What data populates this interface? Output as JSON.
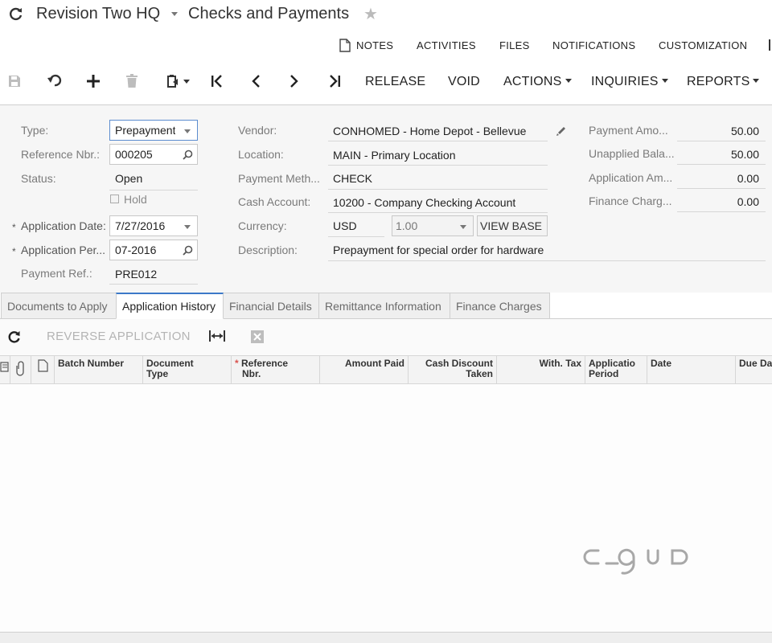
{
  "header": {
    "company": "Revision Two HQ",
    "title": "Checks and Payments"
  },
  "aux_links": [
    "NOTES",
    "ACTIVITIES",
    "FILES",
    "NOTIFICATIONS",
    "CUSTOMIZATION"
  ],
  "toolbar": {
    "release": "RELEASE",
    "void": "VOID",
    "actions": "ACTIONS",
    "inquiries": "INQUIRIES",
    "reports": "REPORTS"
  },
  "form": {
    "type_label": "Type:",
    "type_value": "Prepayment",
    "ref_label": "Reference Nbr.:",
    "ref_value": "000205",
    "status_label": "Status:",
    "status_value": "Open",
    "hold_label": "Hold",
    "app_date_label": "Application Date:",
    "app_date_value": "7/27/2016",
    "app_period_label": "Application Per...",
    "app_period_value": "07-2016",
    "payment_ref_label": "Payment Ref.:",
    "payment_ref_value": "PRE012",
    "vendor_label": "Vendor:",
    "vendor_value": "CONHOMED - Home Depot - Bellevue",
    "location_label": "Location:",
    "location_value": "MAIN - Primary Location",
    "payment_method_label": "Payment Meth...",
    "payment_method_value": "CHECK",
    "cash_account_label": "Cash Account:",
    "cash_account_value": "10200 - Company Checking Account",
    "currency_label": "Currency:",
    "currency_value": "USD",
    "rate_value": "1.00",
    "view_base": "VIEW BASE",
    "description_label": "Description:",
    "description_value": "Prepayment for special order for hardware",
    "payment_amount_label": "Payment Amo...",
    "payment_amount_value": "50.00",
    "unapplied_label": "Unapplied Bala...",
    "unapplied_value": "50.00",
    "application_amount_label": "Application Am...",
    "application_amount_value": "0.00",
    "finance_charges_label": "Finance Charg...",
    "finance_charges_value": "0.00"
  },
  "tabs": [
    "Documents to Apply",
    "Application History",
    "Financial Details",
    "Remittance Information",
    "Finance Charges"
  ],
  "grid": {
    "reverse_application": "REVERSE APPLICATION",
    "columns": {
      "batch_number": "Batch Number",
      "doc_type_1": "Document",
      "doc_type_2": "Type",
      "ref_nbr_1": "Reference",
      "ref_nbr_2": "Nbr.",
      "amount_paid": "Amount Paid",
      "cash_discount_1": "Cash Discount",
      "cash_discount_2": "Taken",
      "with_tax": "With. Tax",
      "app_period_1": "Applicatio",
      "app_period_2": "Period",
      "date": "Date",
      "due_date": "Due Dat"
    }
  },
  "colors": {
    "accent": "#3c79c8",
    "required": "#d9534f"
  }
}
